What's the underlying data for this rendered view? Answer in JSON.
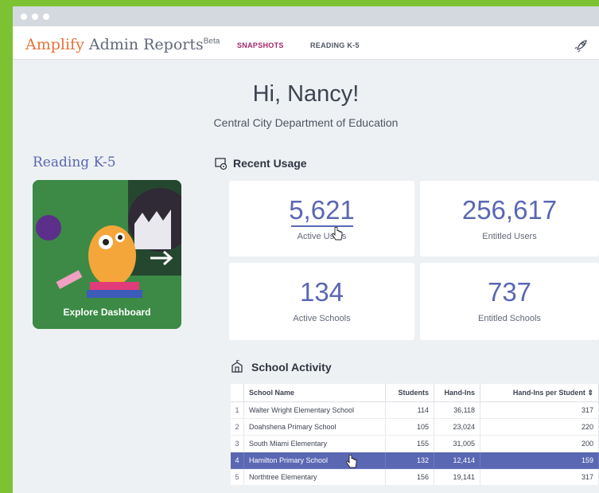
{
  "brand": {
    "name_part1": "Amplify",
    "name_part2": "Admin Reports",
    "badge": "Beta"
  },
  "nav": {
    "tabs": [
      {
        "label": "SNAPSHOTS",
        "active": true
      },
      {
        "label": "READING K-5",
        "active": false
      }
    ],
    "icon": "rocket-icon"
  },
  "greeting": "Hi, Nancy!",
  "organization": "Central City Department of Education",
  "reading": {
    "title": "Reading K-5",
    "tile_label": "Explore Dashboard"
  },
  "usage": {
    "title": "Recent Usage",
    "stats": [
      {
        "value": "5,621",
        "label": "Active Users"
      },
      {
        "value": "256,617",
        "label": "Entitled Users"
      },
      {
        "value": "134",
        "label": "Active Schools"
      },
      {
        "value": "737",
        "label": "Entitled Schools"
      }
    ]
  },
  "activity": {
    "title": "School Activity",
    "columns": [
      "School Name",
      "Students",
      "Hand-Ins",
      "Hand-Ins per Student"
    ],
    "rows": [
      {
        "idx": "1",
        "school": "Walter Wright Elementary School",
        "students": "114",
        "handins": "36,118",
        "per": "317"
      },
      {
        "idx": "2",
        "school": "Doahshena Primary School",
        "students": "105",
        "handins": "23,024",
        "per": "220"
      },
      {
        "idx": "3",
        "school": "South Miami Elementary",
        "students": "155",
        "handins": "31,005",
        "per": "200"
      },
      {
        "idx": "4",
        "school": "Hamilton Primary School",
        "students": "132",
        "handins": "12,414",
        "per": "159"
      },
      {
        "idx": "5",
        "school": "Northtree Elementary",
        "students": "156",
        "handins": "19,141",
        "per": "317"
      }
    ],
    "selected_row": 4
  },
  "colors": {
    "accent": "#5a67b3",
    "brand_orange": "#e5733b",
    "active_tab": "#a4256b",
    "background": "#7cc233"
  }
}
